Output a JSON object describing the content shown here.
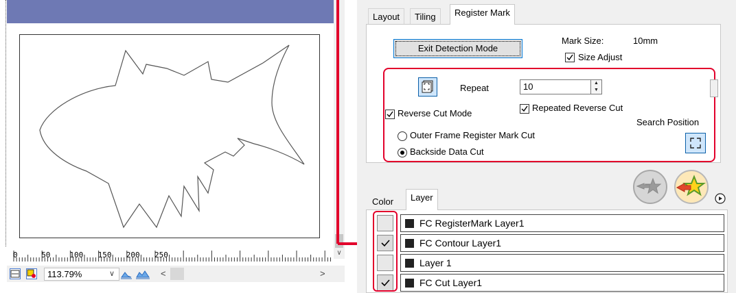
{
  "canvas": {
    "zoom": "113.79%",
    "ruler_labels": [
      "0",
      "50",
      "100",
      "150",
      "200",
      "250"
    ]
  },
  "tabs_top": {
    "items": [
      "Layout",
      "Tiling",
      "Register Mark"
    ],
    "active": "Register Mark"
  },
  "register_mark": {
    "exit_button": "Exit Detection Mode",
    "mark_size_label": "Mark Size:",
    "mark_size_value": "10mm",
    "size_adjust_label": "Size Adjust",
    "size_adjust_checked": true,
    "repeat_label": "Repeat",
    "repeat_value": "10",
    "reverse_cut_mode_label": "Reverse Cut Mode",
    "reverse_cut_mode_checked": true,
    "repeated_reverse_cut_label": "Repeated Reverse Cut",
    "repeated_reverse_cut_checked": true,
    "search_position_label": "Search Position",
    "options": [
      {
        "label": "Outer Frame Register Mark Cut",
        "selected": false
      },
      {
        "label": "Backside Data Cut",
        "selected": true
      }
    ]
  },
  "tabs_bottom": {
    "items": [
      "Color",
      "Layer"
    ],
    "active": "Layer"
  },
  "layers": [
    {
      "name": "FC RegisterMark Layer1",
      "checked": false
    },
    {
      "name": "FC Contour Layer1",
      "checked": true
    },
    {
      "name": "Layer 1",
      "checked": false
    },
    {
      "name": "FC Cut Layer1",
      "checked": true
    }
  ],
  "colors": {
    "highlight_red": "#e2002b",
    "title_bar": "#6e79b4",
    "selection_blue": "#0078d7"
  }
}
